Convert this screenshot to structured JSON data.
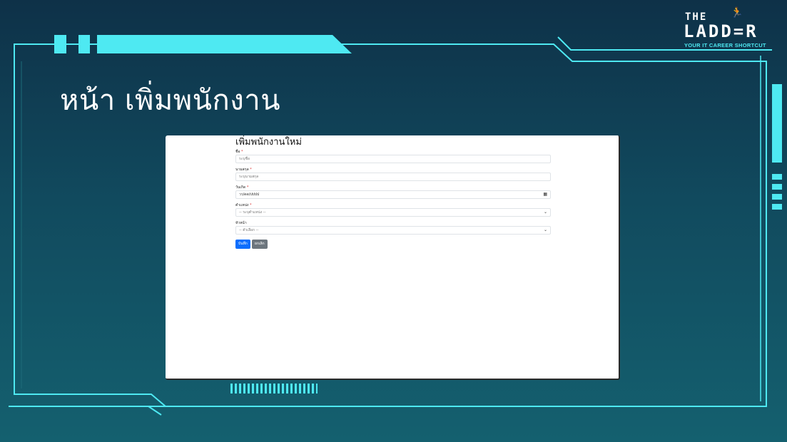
{
  "slide": {
    "title": "หน้า เพิ่มพนักงาน"
  },
  "logo": {
    "line1": "THE",
    "line2": "LADD=R",
    "tagline": "YOUR IT CAREER SHORTCUT",
    "mascot_icon": "runner-icon"
  },
  "form": {
    "title": "เพิ่มพนักงานใหม่",
    "fields": [
      {
        "label": "ชื่อ",
        "required": "*",
        "value": "",
        "placeholder": "ระบุชื่อ"
      },
      {
        "label": "นามสกุล",
        "required": "*",
        "value": "",
        "placeholder": "ระบุนามสกุล"
      },
      {
        "label": "วันเกิด",
        "required": "*",
        "value": "วว/ดด/ปปปป",
        "icon": "calendar-icon"
      },
      {
        "label": "ตำแหน่ง",
        "required": "*",
        "value": "-- ระบุตำแหน่ง --",
        "icon": "chevron-down-icon"
      },
      {
        "label": "หัวหน้า",
        "required": "",
        "value": "-- ตัวเลือก --",
        "icon": "chevron-down-icon"
      }
    ],
    "save_label": "บันทึก",
    "cancel_label": "ยกเลิก"
  },
  "colors": {
    "accent": "#4ee9f2",
    "primary_button": "#0d6efd",
    "secondary_button": "#6c757d",
    "background_top": "#0e3148",
    "background_bottom": "#14606f"
  }
}
